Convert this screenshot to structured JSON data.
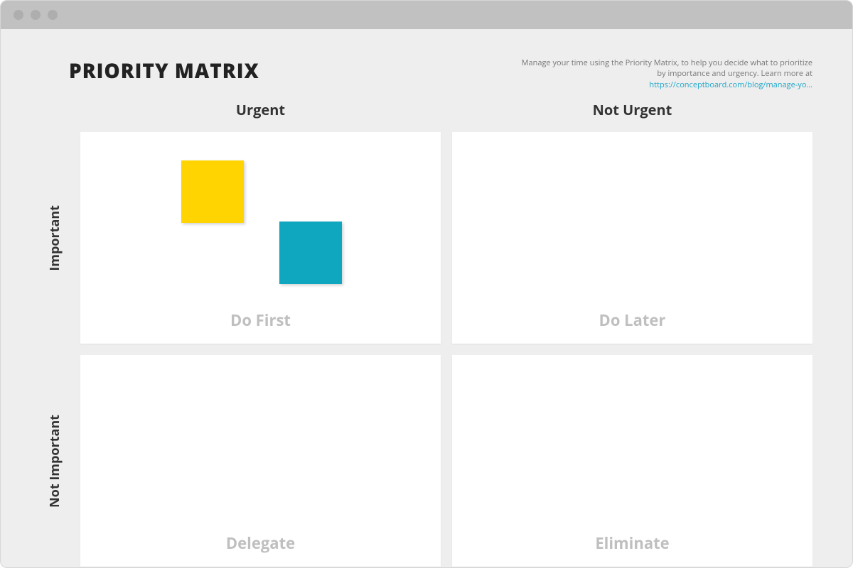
{
  "header": {
    "title": "PRIORITY MATRIX",
    "description_text": "Manage your time using the Priority Matrix, to help you decide what to prioritize by importance and urgency. Learn more at ",
    "description_link_text": "https://conceptboard.com/blog/manage-yo…"
  },
  "columns": {
    "left": "Urgent",
    "right": "Not Urgent"
  },
  "rows": {
    "top": "Important",
    "bottom": "Not Important"
  },
  "quadrants": {
    "q1": "Do First",
    "q2": "Do Later",
    "q3": "Delegate",
    "q4": "Eliminate"
  },
  "stickies": [
    {
      "color": "yellow",
      "quadrant": "q1"
    },
    {
      "color": "teal",
      "quadrant": "q1"
    }
  ],
  "colors": {
    "sticky_yellow": "#ffd400",
    "sticky_teal": "#0fa6bf",
    "link": "#1ca6c9"
  }
}
